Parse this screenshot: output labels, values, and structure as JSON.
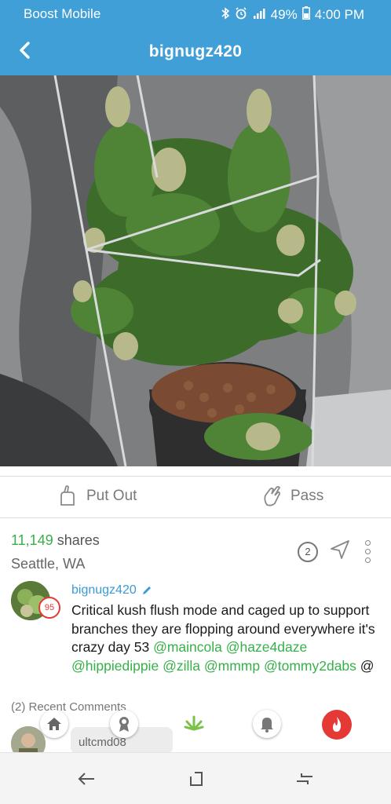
{
  "status_bar": {
    "carrier": "Boost Mobile",
    "battery": "49%",
    "time": "4:00 PM",
    "icons": [
      "bluetooth-icon",
      "alarm-icon",
      "lte-signal-icon",
      "battery-icon"
    ]
  },
  "header": {
    "title": "bignugz420",
    "back_icon": "chevron-left-icon",
    "background": "#3f9fd6"
  },
  "photo": {
    "subject": "cannabis plant in tent with tomato cage"
  },
  "actions": {
    "put_out_label": "Put Out",
    "pass_label": "Pass"
  },
  "post": {
    "shares_count": "11,149",
    "shares_label": "shares",
    "location": "Seattle, WA",
    "comment_count": "2",
    "author": "bignugz420",
    "level": "95",
    "caption_text": "Critical kush flush mode and caged up to support branches they are flopping around everywhere it's crazy day 53",
    "mentions": [
      "@maincola",
      "@haze4daze",
      "@hippiedippie",
      "@zilla",
      "@mmmp",
      "@tommy2dabs"
    ],
    "trailing": "@"
  },
  "comments": {
    "label": "(2) Recent Comments",
    "first_author": "ultcmd08"
  },
  "bottom_tabs": [
    "home-icon",
    "award-icon",
    "weed-leaf-icon",
    "bell-icon",
    "fire-icon"
  ],
  "colors": {
    "accent": "#3f9fd6",
    "mention": "#37b04a",
    "badge": "#e53935"
  }
}
